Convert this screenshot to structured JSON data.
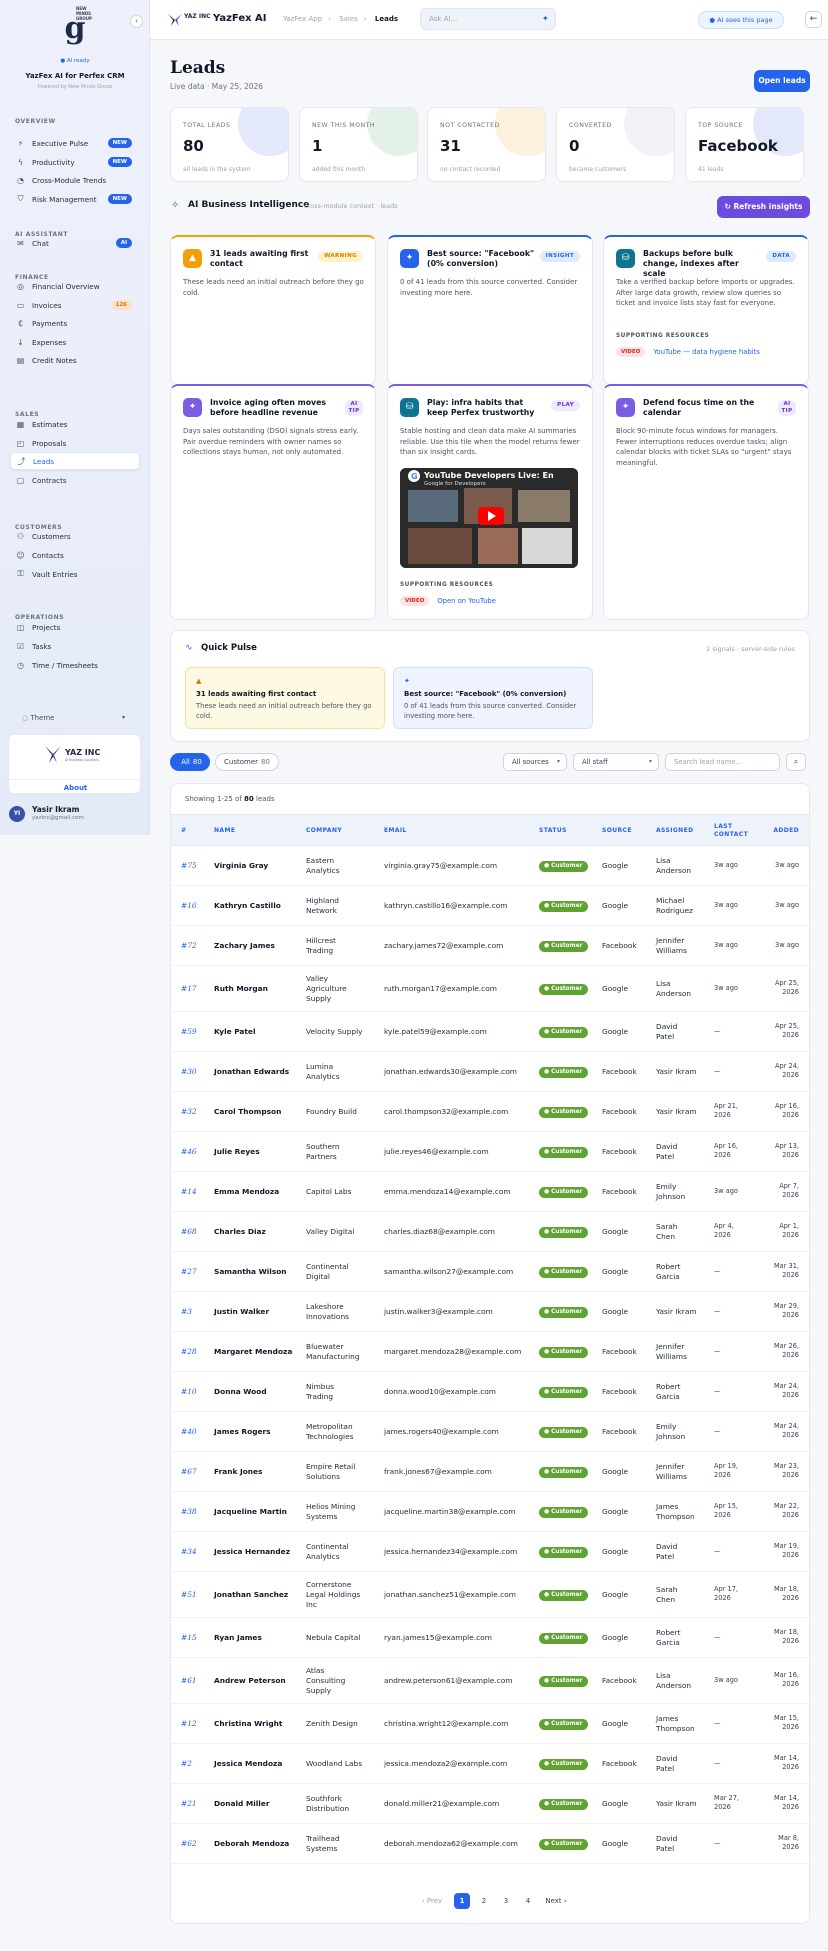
{
  "sidebar": {
    "brand_sub": "NEW\nMINDS\nGROUP",
    "ai_ready": "● AI ready",
    "title": "YazFex AI for Perfex CRM",
    "powered": "Powered by New Minds Group",
    "sections": {
      "overview": "OVERVIEW",
      "ai": "AI ASSISTANT",
      "finance": "FINANCE",
      "sales": "SALES",
      "customers": "CUSTOMERS",
      "operations": "OPERATIONS"
    },
    "items": [
      {
        "label": "Executive Pulse",
        "icon": "pulse-icon",
        "badge": "NEW"
      },
      {
        "label": "Productivity",
        "icon": "bolt-icon",
        "badge": "NEW"
      },
      {
        "label": "Cross-Module Trends",
        "icon": "trend-icon",
        "badge": ""
      },
      {
        "label": "Risk Management",
        "icon": "shield-icon",
        "badge": "NEW"
      },
      {
        "label": "Chat",
        "icon": "chat-icon",
        "badge": "AI"
      },
      {
        "label": "Financial Overview",
        "icon": "finance-icon",
        "badge": ""
      },
      {
        "label": "Invoices",
        "icon": "invoice-icon",
        "badge": "126"
      },
      {
        "label": "Payments",
        "icon": "payment-icon",
        "badge": ""
      },
      {
        "label": "Expenses",
        "icon": "expense-icon",
        "badge": ""
      },
      {
        "label": "Credit Notes",
        "icon": "credit-note-icon",
        "badge": ""
      },
      {
        "label": "Estimates",
        "icon": "estimate-icon",
        "badge": ""
      },
      {
        "label": "Proposals",
        "icon": "proposal-icon",
        "badge": ""
      },
      {
        "label": "Leads",
        "icon": "leads-icon",
        "badge": ""
      },
      {
        "label": "Contracts",
        "icon": "contract-icon",
        "badge": ""
      },
      {
        "label": "Customers",
        "icon": "customers-icon",
        "badge": ""
      },
      {
        "label": "Contacts",
        "icon": "contacts-icon",
        "badge": ""
      },
      {
        "label": "Vault Entries",
        "icon": "vault-icon",
        "badge": ""
      },
      {
        "label": "Projects",
        "icon": "projects-icon",
        "badge": ""
      },
      {
        "label": "Tasks",
        "icon": "tasks-icon",
        "badge": ""
      },
      {
        "label": "Time / Timesheets",
        "icon": "clock-icon",
        "badge": ""
      }
    ],
    "theme": "Theme",
    "company_name": "YAZ INC",
    "company_tagline": "AI Business Solutions",
    "about": "About",
    "user": {
      "initials": "YI",
      "name": "Yasir Ikram",
      "email": "yazinc@gmail.com"
    }
  },
  "topbar": {
    "logo": "YAZ INC",
    "title": "YazFex AI",
    "crumbs": [
      "YazFex App",
      "Sales",
      "Leads"
    ],
    "ask_placeholder": "Ask AI...",
    "ai_sees": "AI sees this page",
    "back": "←"
  },
  "header": {
    "title": "Leads",
    "subtitle": "Live data · May 25, 2026",
    "open_leads": "Open leads"
  },
  "kpis": [
    {
      "label": "TOTAL LEADS",
      "value": "80",
      "sub": "all leads in the system",
      "blob": "#e3e9fb"
    },
    {
      "label": "NEW THIS MONTH",
      "value": "1",
      "sub": "added this month",
      "blob": "#e4f1e6"
    },
    {
      "label": "NOT CONTACTED",
      "value": "31",
      "sub": "no contact recorded",
      "blob": "#fdf0dc"
    },
    {
      "label": "CONVERTED",
      "value": "0",
      "sub": "became customers",
      "blob": "#f0f2f6"
    },
    {
      "label": "TOP SOURCE",
      "value": "Facebook",
      "sub": "41 leads",
      "blob": "#e3e9fb"
    }
  ],
  "aibi": {
    "title": "AI Business Intelligence",
    "sub": "cross-module context · leads",
    "refresh": "Refresh insights"
  },
  "cards": [
    {
      "title": "31 leads awaiting first contact",
      "tag": "WARNING",
      "tag_bg": "#fef3c7",
      "tag_fg": "#d97706",
      "icon_bg": "#f59e0b",
      "border": "#f59e0b",
      "icon": "warning-icon",
      "body": "These leads need an initial outreach before they go cold."
    },
    {
      "title": "Best source: \"Facebook\" (0% conversion)",
      "tag": "INSIGHT",
      "tag_bg": "#dbeafe",
      "tag_fg": "#2563eb",
      "icon_bg": "#2563eb",
      "border": "#2563eb",
      "icon": "sparkle-icon",
      "body": "0 of 41 leads from this source converted. Consider investing more here."
    },
    {
      "title": "Backups before bulk change, indexes after scale",
      "tag": "DATA",
      "tag_bg": "#dbeafe",
      "tag_fg": "#2563eb",
      "icon_bg": "#0e7490",
      "border": "#2563eb",
      "icon": "database-icon",
      "body": "Take a verified backup before imports or upgrades. After large data growth, review slow queries so ticket and invoice lists stay fast for everyone.",
      "res_h": "SUPPORTING RESOURCES",
      "res_tag": "VIDEO",
      "res_link": "YouTube — data hygiene habits"
    },
    {
      "title": "Invoice aging often moves before headline revenue",
      "tag": "AI TIP",
      "tag_bg": "#ede9fe",
      "tag_fg": "#6d28d9",
      "icon_bg": "#7c5ce0",
      "border": "#7c5ce0",
      "icon": "sparkle-icon",
      "body": "Days sales outstanding (DSO) signals stress early. Pair overdue reminders with owner names so collections stays human, not only automated."
    },
    {
      "title": "Play: infra habits that keep Perfex trustworthy",
      "tag": "PLAY",
      "tag_bg": "#ede9fe",
      "tag_fg": "#6d28d9",
      "icon_bg": "#0e7490",
      "border": "#7c5ce0",
      "icon": "database-icon",
      "body": "Stable hosting and clean data make AI summaries reliable. Use this tile when the model returns fewer than six insight cards.",
      "video_title": "YouTube Developers Live: En",
      "video_sub": "Google for Developers",
      "res_h": "SUPPORTING RESOURCES",
      "res_tag": "VIDEO",
      "res_link": "Open on YouTube"
    },
    {
      "title": "Defend focus time on the calendar",
      "tag": "AI TIP",
      "tag_bg": "#ede9fe",
      "tag_fg": "#6d28d9",
      "icon_bg": "#7c5ce0",
      "border": "#7c5ce0",
      "icon": "sparkle-icon",
      "body": "Block 90-minute focus windows for managers. Fewer interruptions reduces overdue tasks; align calendar blocks with ticket SLAs so \"urgent\" stays meaningful."
    }
  ],
  "pulse": {
    "title": "Quick Pulse",
    "sub": "2 signals · server-side rules",
    "items": [
      {
        "icon": "warning-icon",
        "title": "31 leads awaiting first contact",
        "body": "These leads need an initial outreach before they go cold.",
        "bg": "#fef9e3",
        "border": "#f5e2a3",
        "icolor": "#d97706"
      },
      {
        "icon": "sparkle-icon",
        "title": "Best source: \"Facebook\" (0% conversion)",
        "body": "0 of 41 leads from this source converted. Consider investing more here.",
        "bg": "#eef3fd",
        "border": "#d5e1f7",
        "icolor": "#2563eb"
      }
    ]
  },
  "filters": {
    "all": "All",
    "all_count": "80",
    "customer": "Customer",
    "customer_count": "80",
    "sources": "All sources",
    "staff": "All staff",
    "search_placeholder": "Search lead name..."
  },
  "table": {
    "showing_pre": "Showing 1-25 of ",
    "showing_total": "80",
    "showing_post": " leads",
    "headers": [
      "#",
      "NAME",
      "COMPANY",
      "EMAIL",
      "STATUS",
      "SOURCE",
      "ASSIGNED",
      "LAST\nCONTACT",
      "ADDED"
    ],
    "rows": [
      {
        "id": "#75",
        "name": "Virginia Gray",
        "company": "Eastern\nAnalytics",
        "email": "virginia.gray75@example.com",
        "status": "● Customer",
        "source": "Google",
        "assigned": "Lisa\nAnderson",
        "last": "3w ago",
        "added": "3w ago"
      },
      {
        "id": "#16",
        "name": "Kathryn Castillo",
        "company": "Highland\nNetwork",
        "email": "kathryn.castillo16@example.com",
        "status": "● Customer",
        "source": "Google",
        "assigned": "Michael\nRodriguez",
        "last": "3w ago",
        "added": "3w ago"
      },
      {
        "id": "#72",
        "name": "Zachary James",
        "company": "Hillcrest\nTrading",
        "email": "zachary.james72@example.com",
        "status": "● Customer",
        "source": "Facebook",
        "assigned": "Jennifer\nWilliams",
        "last": "3w ago",
        "added": "3w ago"
      },
      {
        "id": "#17",
        "name": "Ruth Morgan",
        "company": "Valley\nAgriculture\nSupply",
        "email": "ruth.morgan17@example.com",
        "status": "● Customer",
        "source": "Google",
        "assigned": "Lisa\nAnderson",
        "last": "3w ago",
        "added": "Apr 25,\n2026"
      },
      {
        "id": "#59",
        "name": "Kyle Patel",
        "company": "Velocity Supply",
        "email": "kyle.patel59@example.com",
        "status": "● Customer",
        "source": "Google",
        "assigned": "David\nPatel",
        "last": "—",
        "added": "Apr 25,\n2026"
      },
      {
        "id": "#30",
        "name": "Jonathan Edwards",
        "company": "Lumina\nAnalytics",
        "email": "jonathan.edwards30@example.com",
        "status": "● Customer",
        "source": "Facebook",
        "assigned": "Yasir Ikram",
        "last": "—",
        "added": "Apr 24,\n2026"
      },
      {
        "id": "#32",
        "name": "Carol Thompson",
        "company": "Foundry Build",
        "email": "carol.thompson32@example.com",
        "status": "● Customer",
        "source": "Facebook",
        "assigned": "Yasir Ikram",
        "last": "Apr 21,\n2026",
        "added": "Apr 16,\n2026"
      },
      {
        "id": "#46",
        "name": "Julie Reyes",
        "company": "Southern\nPartners",
        "email": "julie.reyes46@example.com",
        "status": "● Customer",
        "source": "Facebook",
        "assigned": "David\nPatel",
        "last": "Apr 16,\n2026",
        "added": "Apr 13,\n2026"
      },
      {
        "id": "#14",
        "name": "Emma Mendoza",
        "company": "Capitol Labs",
        "email": "emma.mendoza14@example.com",
        "status": "● Customer",
        "source": "Facebook",
        "assigned": "Emily\nJohnson",
        "last": "3w ago",
        "added": "Apr 7,\n2026"
      },
      {
        "id": "#68",
        "name": "Charles Diaz",
        "company": "Valley Digital",
        "email": "charles.diaz68@example.com",
        "status": "● Customer",
        "source": "Google",
        "assigned": "Sarah\nChen",
        "last": "Apr 4,\n2026",
        "added": "Apr 1,\n2026"
      },
      {
        "id": "#27",
        "name": "Samantha Wilson",
        "company": "Continental\nDigital",
        "email": "samantha.wilson27@example.com",
        "status": "● Customer",
        "source": "Google",
        "assigned": "Robert\nGarcia",
        "last": "—",
        "added": "Mar 31,\n2026"
      },
      {
        "id": "#3",
        "name": "Justin Walker",
        "company": "Lakeshore\nInnovations",
        "email": "justin.walker3@example.com",
        "status": "● Customer",
        "source": "Google",
        "assigned": "Yasir Ikram",
        "last": "—",
        "added": "Mar 29,\n2026"
      },
      {
        "id": "#28",
        "name": "Margaret Mendoza",
        "company": "Bluewater\nManufacturing",
        "email": "margaret.mendoza28@example.com",
        "status": "● Customer",
        "source": "Facebook",
        "assigned": "Jennifer\nWilliams",
        "last": "—",
        "added": "Mar 26,\n2026"
      },
      {
        "id": "#10",
        "name": "Donna Wood",
        "company": "Nimbus\nTrading",
        "email": "donna.wood10@example.com",
        "status": "● Customer",
        "source": "Facebook",
        "assigned": "Robert\nGarcia",
        "last": "—",
        "added": "Mar 24,\n2026"
      },
      {
        "id": "#40",
        "name": "James Rogers",
        "company": "Metropolitan\nTechnologies",
        "email": "james.rogers40@example.com",
        "status": "● Customer",
        "source": "Facebook",
        "assigned": "Emily\nJohnson",
        "last": "—",
        "added": "Mar 24,\n2026"
      },
      {
        "id": "#67",
        "name": "Frank Jones",
        "company": "Empire Retail\nSolutions",
        "email": "frank.jones67@example.com",
        "status": "● Customer",
        "source": "Google",
        "assigned": "Jennifer\nWilliams",
        "last": "Apr 19,\n2026",
        "added": "Mar 23,\n2026"
      },
      {
        "id": "#38",
        "name": "Jacqueline Martin",
        "company": "Helios Mining\nSystems",
        "email": "jacqueline.martin38@example.com",
        "status": "● Customer",
        "source": "Google",
        "assigned": "James\nThompson",
        "last": "Apr 15,\n2026",
        "added": "Mar 22,\n2026"
      },
      {
        "id": "#34",
        "name": "Jessica Hernandez",
        "company": "Continental\nAnalytics",
        "email": "jessica.hernandez34@example.com",
        "status": "● Customer",
        "source": "Google",
        "assigned": "David\nPatel",
        "last": "—",
        "added": "Mar 19,\n2026"
      },
      {
        "id": "#51",
        "name": "Jonathan Sanchez",
        "company": "Cornerstone\nLegal Holdings\nInc",
        "email": "jonathan.sanchez51@example.com",
        "status": "● Customer",
        "source": "Google",
        "assigned": "Sarah\nChen",
        "last": "Apr 17,\n2026",
        "added": "Mar 18,\n2026"
      },
      {
        "id": "#15",
        "name": "Ryan James",
        "company": "Nebula Capital",
        "email": "ryan.james15@example.com",
        "status": "● Customer",
        "source": "Google",
        "assigned": "Robert\nGarcia",
        "last": "—",
        "added": "Mar 18,\n2026"
      },
      {
        "id": "#61",
        "name": "Andrew Peterson",
        "company": "Atlas\nConsulting\nSupply",
        "email": "andrew.peterson61@example.com",
        "status": "● Customer",
        "source": "Facebook",
        "assigned": "Lisa\nAnderson",
        "last": "3w ago",
        "added": "Mar 16,\n2026"
      },
      {
        "id": "#12",
        "name": "Christina Wright",
        "company": "Zenith Design",
        "email": "christina.wright12@example.com",
        "status": "● Customer",
        "source": "Google",
        "assigned": "James\nThompson",
        "last": "—",
        "added": "Mar 15,\n2026"
      },
      {
        "id": "#2",
        "name": "Jessica Mendoza",
        "company": "Woodland Labs",
        "email": "jessica.mendoza2@example.com",
        "status": "● Customer",
        "source": "Facebook",
        "assigned": "David\nPatel",
        "last": "—",
        "added": "Mar 14,\n2026"
      },
      {
        "id": "#21",
        "name": "Donald Miller",
        "company": "Southfork\nDistribution",
        "email": "donald.miller21@example.com",
        "status": "● Customer",
        "source": "Google",
        "assigned": "Yasir Ikram",
        "last": "Mar 27,\n2026",
        "added": "Mar 14,\n2026"
      },
      {
        "id": "#62",
        "name": "Deborah Mendoza",
        "company": "Trailhead\nSystems",
        "email": "deborah.mendoza62@example.com",
        "status": "● Customer",
        "source": "Google",
        "assigned": "David\nPatel",
        "last": "—",
        "added": "Mar 8,\n2026"
      }
    ],
    "pager": {
      "prev": "‹ Prev",
      "pages": [
        "1",
        "2",
        "3",
        "4"
      ],
      "next": "Next ›"
    }
  }
}
